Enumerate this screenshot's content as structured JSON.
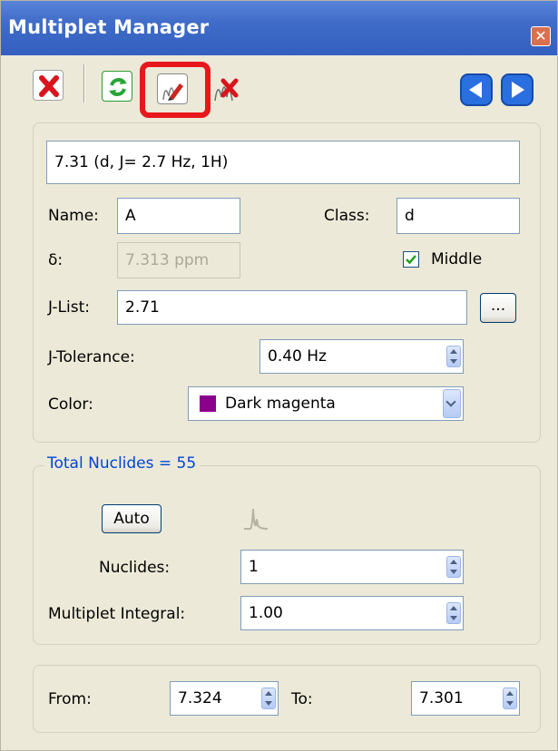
{
  "window": {
    "title": "Multiplet Manager",
    "close_glyph": "✕"
  },
  "toolbar": {
    "icons": [
      "delete-icon",
      "refresh-icon",
      "edit-multiplet-icon",
      "remove-multiplet-icon",
      "previous-arrow-icon",
      "next-arrow-icon"
    ],
    "highlighted": "edit-multiplet-icon"
  },
  "summary": {
    "text": "7.31 (d, J= 2.7 Hz, 1H)"
  },
  "form": {
    "name_label": "Name:",
    "name_value": "A",
    "class_label": "Class:",
    "class_value": "d",
    "delta_label": "δ:",
    "delta_value": "7.313 ppm",
    "middle_label": "Middle",
    "middle_checked": true,
    "jlist_label": "J-List:",
    "jlist_value": "2.71",
    "jlist_button": "...",
    "jtol_label": "J-Tolerance:",
    "jtol_value": "0.40 Hz",
    "color_label": "Color:",
    "color_value": "Dark magenta",
    "color_swatch": "#8b008b"
  },
  "nuclides": {
    "legend": "Total Nuclides = 55",
    "auto_button": "Auto",
    "nuclides_label": "Nuclides:",
    "nuclides_value": "1",
    "integral_label": "Multiplet Integral:",
    "integral_value": "1.00"
  },
  "range": {
    "from_label": "From:",
    "from_value": "7.324",
    "to_label": "To:",
    "to_value": "7.301"
  }
}
